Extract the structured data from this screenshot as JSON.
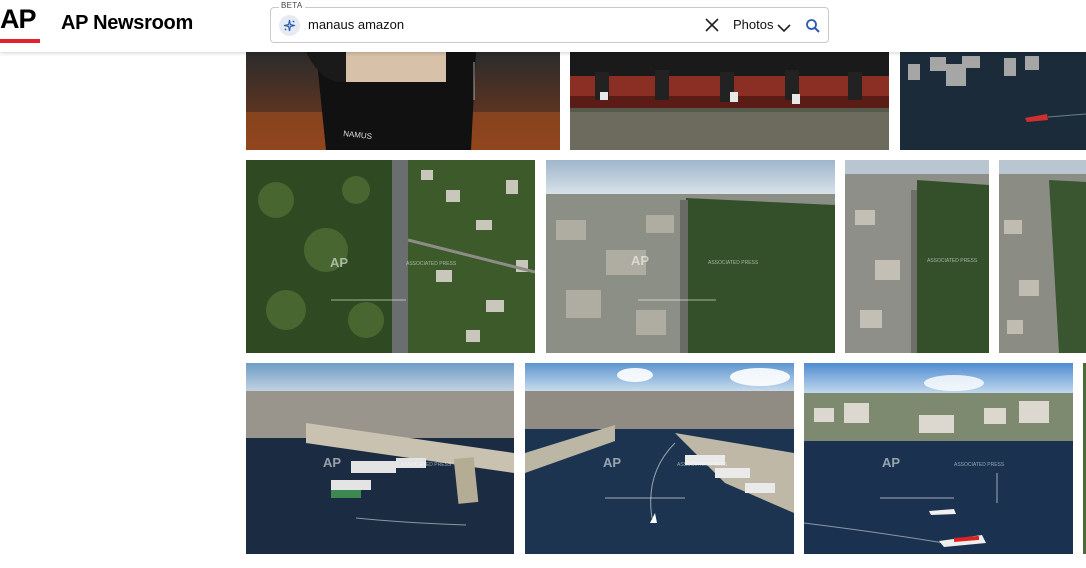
{
  "header": {
    "logo_text": "AP",
    "brand": "AP Newsroom"
  },
  "search": {
    "badge": "BETA",
    "query": "manaus amazon",
    "media_type": "Photos"
  },
  "photos": {
    "watermark_logo": "AP",
    "watermark_text": "ASSOCIATED PRESS",
    "jersey_text": "NAMUS"
  },
  "colors": {
    "accent_red": "#e0232e",
    "search_icon": "#2a5db0"
  }
}
